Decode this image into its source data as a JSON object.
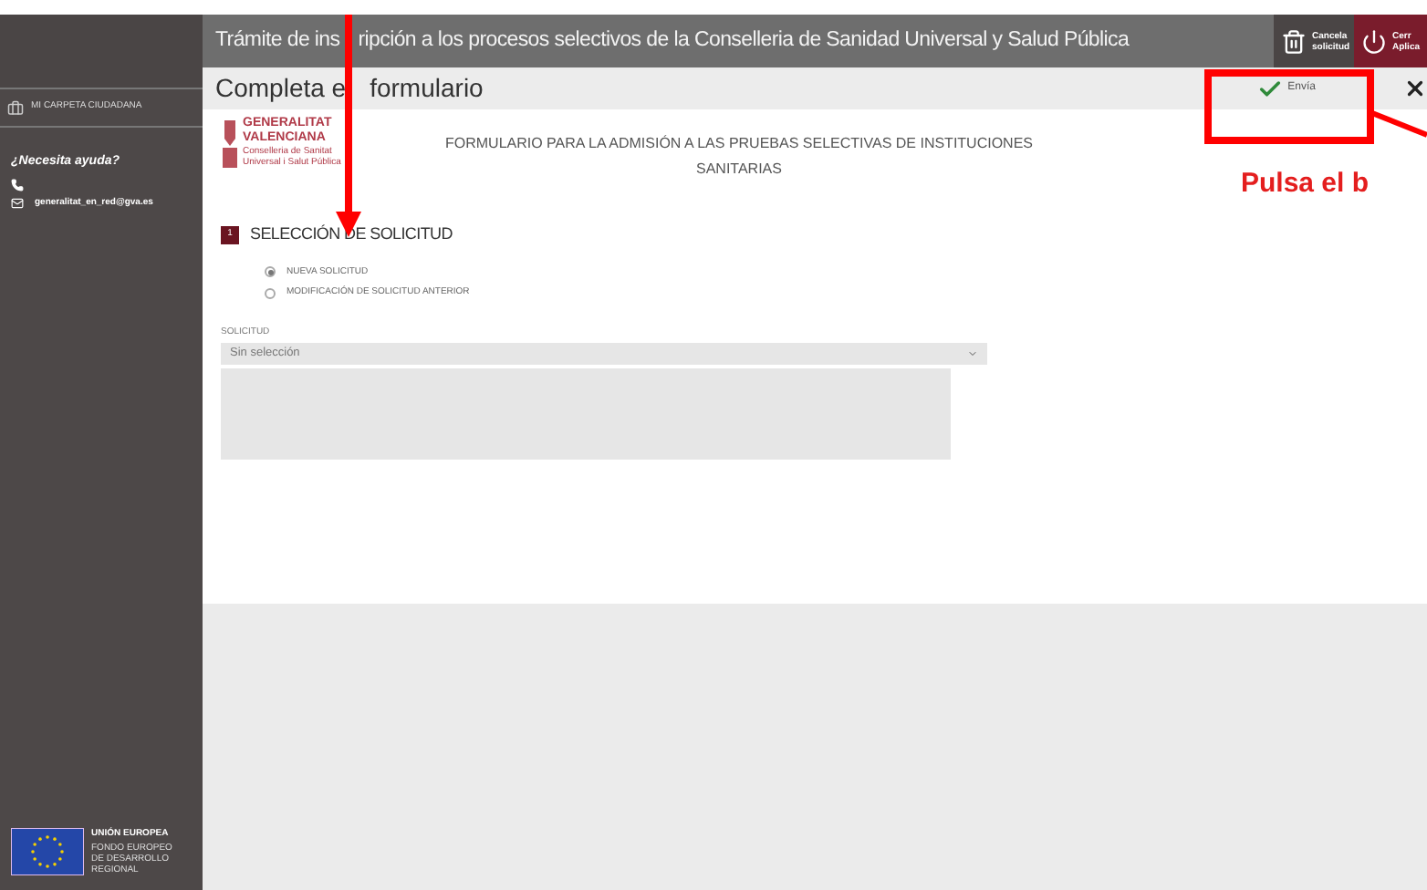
{
  "sidebar": {
    "folder_link": "MI CARPETA CIUDADANA",
    "help_title": "¿Necesita ayuda?",
    "email": "generalitat_en_red@gva.es",
    "eu_logo": {
      "title": "UNIÓN EUROPEA",
      "subtitle": "FONDO EUROPEO DE DESARROLLO REGIONAL"
    }
  },
  "header": {
    "title_parts": [
      "Trámite de ins",
      "ripción a los procesos selectivos de la Conselleria de Sanidad Universal y Salud Pública"
    ],
    "buttons": [
      {
        "kind": "trash",
        "label": "Cancela solicitud"
      },
      {
        "kind": "power",
        "label": "Cerr Aplica"
      }
    ]
  },
  "toolbar": {
    "title_parts": [
      "Completa e",
      "formulario"
    ],
    "send_label": "Envía"
  },
  "form": {
    "logo": {
      "name_line1": "GENERALITAT",
      "name_line2": "VALENCIANA",
      "department": "Conselleria de Sanitat Universal i Salut Pública"
    },
    "title": "FORMULARIO PARA LA ADMISIÓN A LAS PRUEBAS SELECTIVAS DE INSTITUCIONES SANITARIAS",
    "section": {
      "number": "1",
      "title": "SELECCIÓN DE SOLICITUD"
    },
    "options": [
      {
        "label": "NUEVA SOLICITUD",
        "selected": true
      },
      {
        "label": "MODIFICACIÓN DE SOLICITUD ANTERIOR",
        "selected": false
      }
    ],
    "select": {
      "label": "SOLICITUD",
      "value": "Sin selección"
    }
  },
  "annotations": [
    {
      "kind": "arrow"
    },
    {
      "kind": "box"
    },
    {
      "kind": "line"
    },
    {
      "kind": "text",
      "text": "Pulsa el b"
    }
  ]
}
